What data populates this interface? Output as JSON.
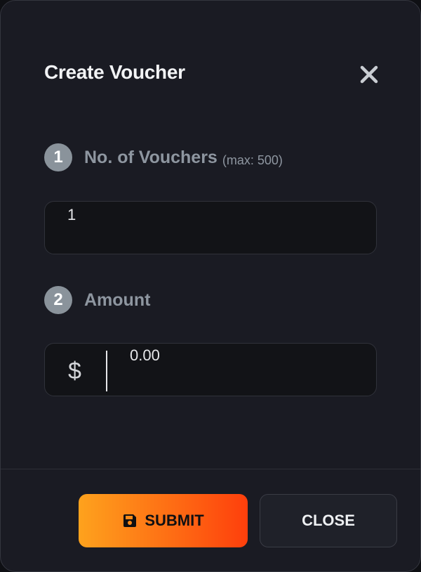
{
  "modal": {
    "title": "Create Voucher"
  },
  "steps": [
    {
      "number": "1",
      "label": "No. of Vouchers",
      "hint": "(max: 500)"
    },
    {
      "number": "2",
      "label": "Amount",
      "hint": ""
    }
  ],
  "fields": {
    "voucher_count": {
      "value": "1"
    },
    "amount": {
      "currency_symbol": "$",
      "placeholder": "0.00"
    }
  },
  "buttons": {
    "submit_label": "SUBMIT",
    "close_label": "CLOSE"
  },
  "icons": {
    "close": "close-icon",
    "submit": "save-icon"
  },
  "colors": {
    "background": "#1a1b23",
    "accent_start": "#fea21d",
    "accent_end": "#fe3f0c",
    "step_badge": "#8a939b"
  }
}
